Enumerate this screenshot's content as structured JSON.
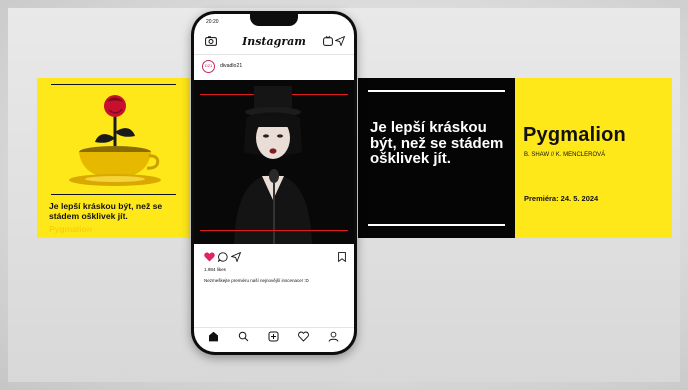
{
  "left_panel": {
    "quote": "Je lepší kráskou být, než se stádem ošklivek jít.",
    "sub": "Pygmalion"
  },
  "phone": {
    "status_time": "20:20",
    "app_title": "Instagram",
    "username": "divadlo21",
    "avatar_text": "D21",
    "likes": "1.984 likes",
    "caption": "Nezmeškejte premiéru naší nejnovější inscenace! :D",
    "icons": [
      "camera-icon",
      "igtv-icon",
      "send-icon",
      "heart-icon",
      "comment-icon",
      "share-icon",
      "bookmark-icon",
      "home-icon",
      "search-icon",
      "add-icon",
      "activity-icon",
      "profile-icon"
    ]
  },
  "black_panel": {
    "quote": "Je lepší kráskou být, než se stádem ošklivek jít."
  },
  "right_panel": {
    "title": "Pygmalion",
    "authors": "B. SHAW // K. MENCLEROVÁ",
    "premiere": "Premiéra: 24. 5. 2024"
  },
  "colors": {
    "yellow": "#ffe81a",
    "black": "#050505",
    "heart": "#e0245e",
    "brand_red": "#c12d57"
  }
}
